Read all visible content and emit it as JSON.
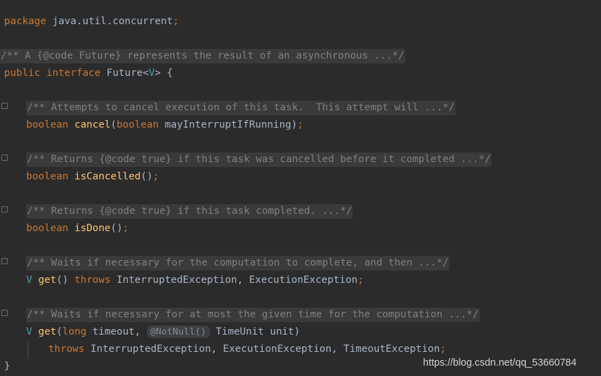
{
  "editor": {
    "theme": "darcula",
    "background_color": "#2b2b2b",
    "language": "java",
    "folded_comment_bg": "#3a3a3a",
    "accent_keyword_color": "#cc7832",
    "method_color": "#ffc66d",
    "identifier_color": "#a9b7c6",
    "type_param_color": "#4f9da6",
    "comment_color": "#808080"
  },
  "code": {
    "line_package_kw": "package",
    "line_package_name": " java.util.concurrent",
    "line_package_semi": ";",
    "fold_comment_interface": "/** A {@code Future} represents the result of an asynchronous ...*/",
    "interface_public": "public",
    "interface_kw": " interface ",
    "interface_name": "Future",
    "interface_lt": "<",
    "interface_tparam": "V",
    "interface_gt": "> ",
    "interface_brace": "{",
    "fold_comment_cancel": "/** Attempts to cancel execution of this task.  This attempt will ...*/",
    "cancel_return": "boolean",
    "cancel_name": " cancel",
    "cancel_paren_open": "(",
    "cancel_param_type": "boolean",
    "cancel_param_name": " mayInterruptIfRunning",
    "cancel_paren_close": ")",
    "cancel_semi": ";",
    "fold_comment_iscancelled": "/** Returns {@code true} if this task was cancelled before it completed ...*/",
    "iscancelled_return": "boolean",
    "iscancelled_name": " isCancelled",
    "iscancelled_parens": "()",
    "iscancelled_semi": ";",
    "fold_comment_isdone": "/** Returns {@code true} if this task completed. ...*/",
    "isdone_return": "boolean",
    "isdone_name": " isDone",
    "isdone_parens": "()",
    "isdone_semi": ";",
    "fold_comment_get": "/** Waits if necessary for the computation to complete, and then ...*/",
    "get_return_type": "V",
    "get_name": " get",
    "get_parens": "() ",
    "get_throws_kw": "throws",
    "get_exc1": " InterruptedException",
    "get_comma": ",",
    "get_exc2": " ExecutionException",
    "get_semi": ";",
    "fold_comment_get_timeout": "/** Waits if necessary for at most the given time for the computation ...*/",
    "gett_return_type": "V",
    "gett_name": " get",
    "gett_paren_open": "(",
    "gett_param1_type": "long",
    "gett_param1_name": " timeout",
    "gett_comma1": ", ",
    "gett_inlay_hint": "@NotNull()",
    "gett_param2_type": " TimeUnit",
    "gett_param2_name": " unit",
    "gett_paren_close": ")",
    "gett_throws_kw": "throws",
    "gett_exc1": " InterruptedException",
    "gett_comma2": ",",
    "gett_exc2": " ExecutionException",
    "gett_comma3": ",",
    "gett_exc3": " TimeoutException",
    "gett_semi": ";",
    "closing_brace": "}"
  },
  "watermark": {
    "text": "https://blog.csdn.net/qq_53660784"
  }
}
